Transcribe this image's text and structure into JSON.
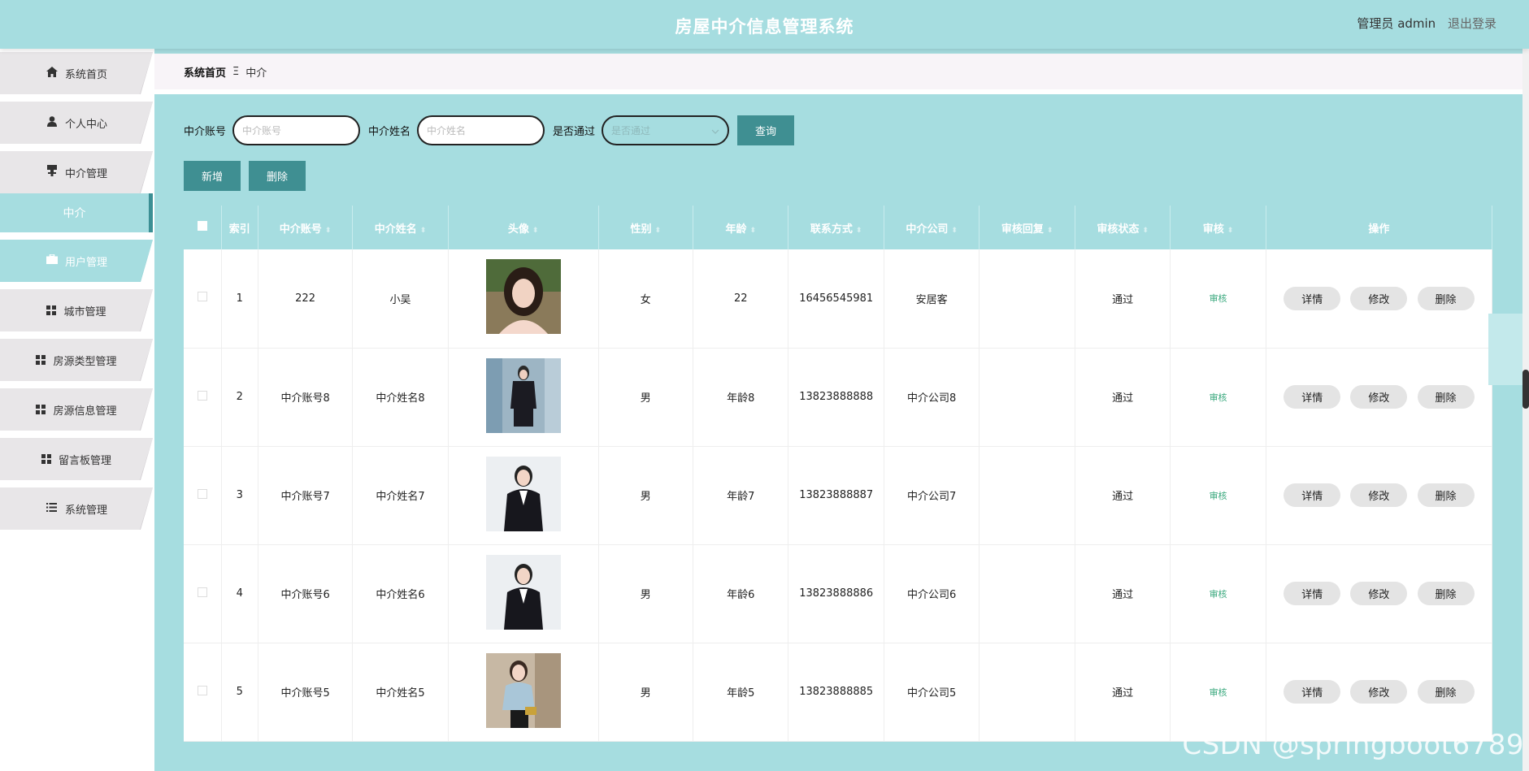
{
  "header": {
    "title": "房屋中介信息管理系统",
    "user": "管理员 admin",
    "logout": "退出登录"
  },
  "sidebar": {
    "items": [
      {
        "label": "系统首页",
        "icon": "home-icon"
      },
      {
        "label": "个人中心",
        "icon": "user-icon"
      },
      {
        "label": "中介管理",
        "icon": "stamp-icon"
      },
      {
        "label": "用户管理",
        "icon": "briefcase-icon"
      },
      {
        "label": "城市管理",
        "icon": "grid-icon"
      },
      {
        "label": "房源类型管理",
        "icon": "grid-icon"
      },
      {
        "label": "房源信息管理",
        "icon": "grid-icon"
      },
      {
        "label": "留言板管理",
        "icon": "grid-icon"
      },
      {
        "label": "系统管理",
        "icon": "list-icon"
      }
    ],
    "sub_item": "中介"
  },
  "breadcrumb": {
    "home": "系统首页",
    "separator": "Ξ",
    "current": "中介"
  },
  "search": {
    "account_label": "中介账号",
    "account_placeholder": "中介账号",
    "name_label": "中介姓名",
    "name_placeholder": "中介姓名",
    "pass_label": "是否通过",
    "pass_placeholder": "是否通过",
    "query_button": "查询"
  },
  "actions": {
    "add": "新增",
    "delete": "删除"
  },
  "table": {
    "columns": [
      "索引",
      "中介账号",
      "中介姓名",
      "头像",
      "性别",
      "年龄",
      "联系方式",
      "中介公司",
      "审核回复",
      "审核状态",
      "审核",
      "操作"
    ],
    "rows": [
      {
        "index": "1",
        "account": "222",
        "name": "小吴",
        "gender": "女",
        "age": "22",
        "phone": "16456545981",
        "company": "安居客",
        "reply": "",
        "status": "通过",
        "review": "审核"
      },
      {
        "index": "2",
        "account": "中介账号8",
        "name": "中介姓名8",
        "gender": "男",
        "age": "年龄8",
        "phone": "13823888888",
        "company": "中介公司8",
        "reply": "",
        "status": "通过",
        "review": "审核"
      },
      {
        "index": "3",
        "account": "中介账号7",
        "name": "中介姓名7",
        "gender": "男",
        "age": "年龄7",
        "phone": "13823888887",
        "company": "中介公司7",
        "reply": "",
        "status": "通过",
        "review": "审核"
      },
      {
        "index": "4",
        "account": "中介账号6",
        "name": "中介姓名6",
        "gender": "男",
        "age": "年龄6",
        "phone": "13823888886",
        "company": "中介公司6",
        "reply": "",
        "status": "通过",
        "review": "审核"
      },
      {
        "index": "5",
        "account": "中介账号5",
        "name": "中介姓名5",
        "gender": "男",
        "age": "年龄5",
        "phone": "13823888885",
        "company": "中介公司5",
        "reply": "",
        "status": "通过",
        "review": "审核"
      }
    ],
    "op_detail": "详情",
    "op_edit": "修改",
    "op_delete": "删除"
  },
  "watermark": "CSDN @springboot6789",
  "colors": {
    "accent": "#a6dde0",
    "button": "#3f8f92",
    "review_link": "#39a87d"
  }
}
